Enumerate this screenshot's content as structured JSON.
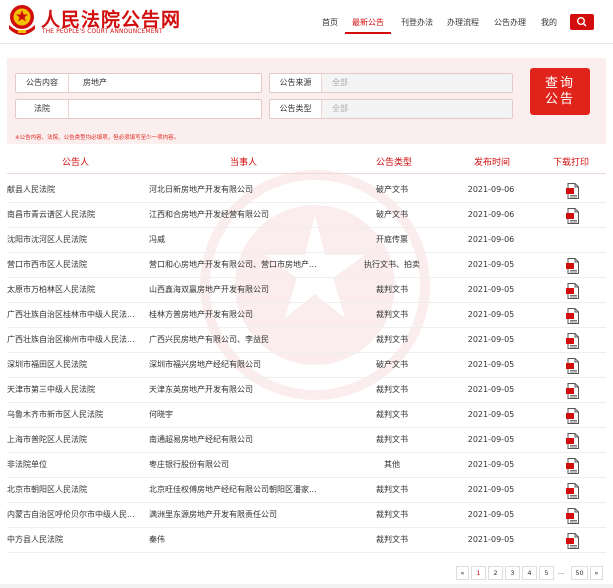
{
  "header": {
    "site_name": "人民法院公告网",
    "site_name_en": "THE PEOPLE'S COURT ANNOUNCEMENT",
    "nav": [
      {
        "label": "首页"
      },
      {
        "label": "最新公告",
        "active": true
      },
      {
        "label": "刊登办法"
      },
      {
        "label": "办理流程"
      },
      {
        "label": "公告办理"
      },
      {
        "label": "我的"
      }
    ]
  },
  "search": {
    "content_label": "公告内容",
    "content_value": "房地产",
    "court_label": "法院",
    "court_value": "",
    "source_label": "公告来源",
    "source_value": "全部",
    "type_label": "公告类型",
    "type_value": "全部",
    "query_label_1": "查询",
    "query_label_2": "公告",
    "note": "※公告内容、法院、公告类型均必填项，但必须填写至少一项内容。"
  },
  "table": {
    "headers": [
      "公告人",
      "当事人",
      "公告类型",
      "发布时间",
      "下载打印"
    ],
    "rows": [
      {
        "court": "献县人民法院",
        "party": "河北日新房地产开发有限公司",
        "type": "破产文书",
        "date": "2021-09-06",
        "pdf": true
      },
      {
        "court": "南昌市青云谱区人民法院",
        "party": "江西和合房地产开发经营有限公司",
        "type": "破产文书",
        "date": "2021-09-06",
        "pdf": true
      },
      {
        "court": "沈阳市沈河区人民法院",
        "party": "冯威",
        "type": "开庭传票",
        "date": "2021-09-06",
        "pdf": false
      },
      {
        "court": "营口市西市区人民法院",
        "party": "营口和心房地产开发有限公司、营口市房地产...",
        "type": "执行文书、拍卖",
        "date": "2021-09-05",
        "pdf": true
      },
      {
        "court": "太原市万柏林区人民法院",
        "party": "山西鑫海双赢房地产开发有限公司",
        "type": "裁判文书",
        "date": "2021-09-05",
        "pdf": true
      },
      {
        "court": "广西壮族自治区桂林市中级人民法...",
        "party": "桂林方普房地产开发有限公司",
        "type": "裁判文书",
        "date": "2021-09-05",
        "pdf": true
      },
      {
        "court": "广西壮族自治区柳州市中级人民法...",
        "party": "广西兴民房地产有限公司、李益民",
        "type": "裁判文书",
        "date": "2021-09-05",
        "pdf": true
      },
      {
        "court": "深圳市福田区人民法院",
        "party": "深圳市福兴房地产经纪有限公司",
        "type": "破产文书",
        "date": "2021-09-05",
        "pdf": true
      },
      {
        "court": "天津市第三中级人民法院",
        "party": "天津东英房地产开发有限公司",
        "type": "裁判文书",
        "date": "2021-09-05",
        "pdf": true
      },
      {
        "court": "乌鲁木齐市新市区人民法院",
        "party": "何晓宇",
        "type": "裁判文书",
        "date": "2021-09-05",
        "pdf": true
      },
      {
        "court": "上海市普陀区人民法院",
        "party": "南通超易房地产经纪有限公司",
        "type": "裁判文书",
        "date": "2021-09-05",
        "pdf": true
      },
      {
        "court": "非法院单位",
        "party": "枣庄银行股份有限公司",
        "type": "其他",
        "date": "2021-09-05",
        "pdf": true
      },
      {
        "court": "北京市朝阳区人民法院",
        "party": "北京旺佳权傅房地产经纪有限公司朝阳区潘家...",
        "type": "裁判文书",
        "date": "2021-09-05",
        "pdf": true
      },
      {
        "court": "内蒙古自治区呼伦贝尔市中级人民...",
        "party": "满洲里东源房地产开发有限责任公司",
        "type": "裁判文书",
        "date": "2021-09-05",
        "pdf": true
      },
      {
        "court": "中方县人民法院",
        "party": "秦伟",
        "type": "裁判文书",
        "date": "2021-09-05",
        "pdf": true
      }
    ]
  },
  "pagination": {
    "prev": "«",
    "pages": [
      "1",
      "2",
      "3",
      "4",
      "5"
    ],
    "current": "1",
    "ellipsis": "...",
    "last": "50",
    "next": "»"
  },
  "colors": {
    "brand": "#d10d0d",
    "button": "#e0241c",
    "panel": "#fbeeee"
  }
}
